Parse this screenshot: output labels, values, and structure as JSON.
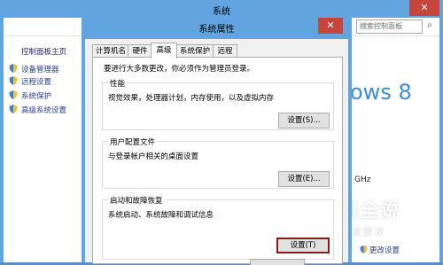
{
  "background_window": {
    "title": "系统",
    "close_glyph": "✕",
    "search_placeholder": "搜索控制面板",
    "sidebar": {
      "home_link": "控制面板主页",
      "items": [
        {
          "label": "设备管理器",
          "icon": "shield-icon"
        },
        {
          "label": "远程设置",
          "icon": "shield-icon"
        },
        {
          "label": "系统保护",
          "icon": "shield-icon"
        },
        {
          "label": "高级系统设置",
          "icon": "shield-icon"
        }
      ]
    },
    "windows_logo_text": "ows 8",
    "cpu_fragment": "GHz",
    "change_settings_link": "更改设置"
  },
  "dialog": {
    "title": "系统属性",
    "close_glyph": "✕",
    "tabs": [
      {
        "label": "计算机名",
        "active": false
      },
      {
        "label": "硬件",
        "active": false
      },
      {
        "label": "高级",
        "active": true
      },
      {
        "label": "系统保护",
        "active": false
      },
      {
        "label": "远程",
        "active": false
      }
    ],
    "admin_note": "要进行大多数更改，你必须作为管理员登录。",
    "performance": {
      "label": "性能",
      "description": "视觉效果，处理器计划，内存使用，以及虚拟内存",
      "button": "设置(S)..."
    },
    "user_profiles": {
      "label": "用户配置文件",
      "description": "与登录帐户相关的桌面设置",
      "button": "设置(E)..."
    },
    "startup_recovery": {
      "label": "启动和故障恢复",
      "description": "系统启动、系统故障和调试信息",
      "button": "设置(T)"
    }
  },
  "watermark": {
    "title": "百科全说",
    "subtitle": "助你轻松解决"
  },
  "colors": {
    "titlebar": "#62a4e0",
    "close_button": "#c7463c",
    "link": "#2a3f8f",
    "focus_border": "#8b1a1a"
  }
}
